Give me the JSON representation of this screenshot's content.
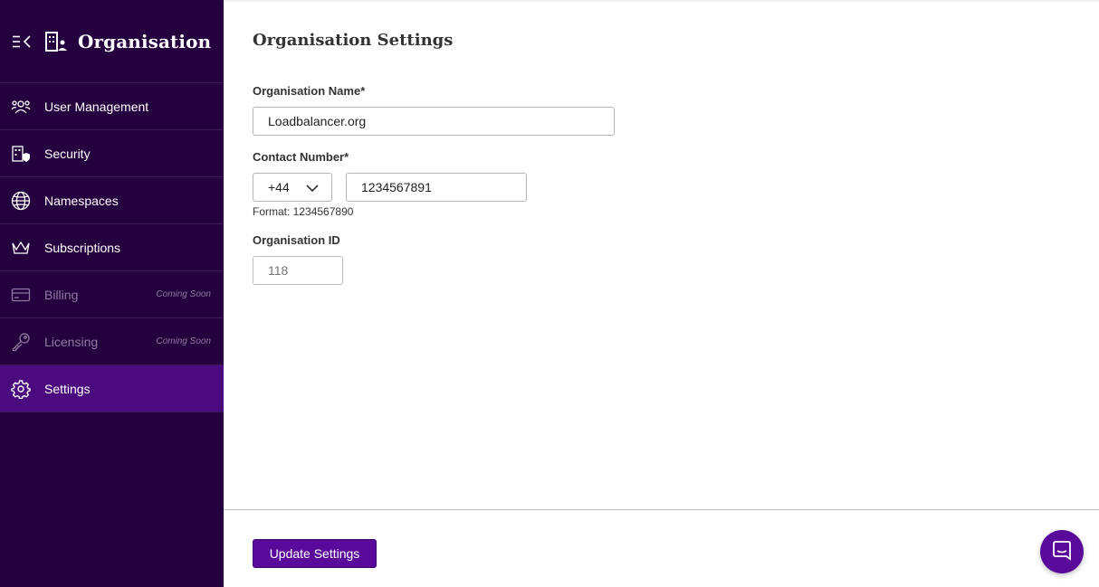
{
  "app": {
    "section_title": "Organisation"
  },
  "sidebar": {
    "items": [
      {
        "label": "User Management",
        "icon": "users-icon"
      },
      {
        "label": "Security",
        "icon": "security-icon"
      },
      {
        "label": "Namespaces",
        "icon": "globe-icon"
      },
      {
        "label": "Subscriptions",
        "icon": "crown-icon"
      },
      {
        "label": "Billing",
        "icon": "credit-card-icon",
        "badge": "Coming Soon",
        "disabled": true
      },
      {
        "label": "Licensing",
        "icon": "key-icon",
        "badge": "Coming Soon",
        "disabled": true
      },
      {
        "label": "Settings",
        "icon": "gear-icon",
        "active": true
      }
    ]
  },
  "main": {
    "title": "Organisation Settings",
    "org_name": {
      "label": "Organisation Name*",
      "value": "Loadbalancer.org"
    },
    "contact": {
      "label": "Contact Number*",
      "country_code": "+44",
      "value": "1234567891",
      "hint": "Format: 1234567890"
    },
    "org_id": {
      "label": "Organisation ID",
      "placeholder": "118"
    },
    "update_button": "Update Settings"
  },
  "colors": {
    "sidebar_bg": "#25003f",
    "active_bg": "#4b0a7e",
    "accent": "#5a0a9a"
  }
}
